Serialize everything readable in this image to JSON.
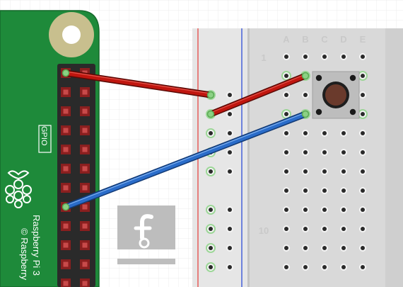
{
  "board": {
    "gpio_label": "GPIO",
    "model_text": "Raspberry Pi 3",
    "copyright_text": "© Raspberry"
  },
  "breadboard": {
    "column_labels": [
      "A",
      "B",
      "C",
      "D",
      "E"
    ],
    "row_labels": [
      "1",
      "10"
    ]
  },
  "colors": {
    "pcb": "#1e8a3a",
    "wire_red": "#c0160f",
    "wire_blue": "#2a6cc9",
    "button_cap": "#6a3a2c",
    "rail_red": "#e53935",
    "rail_blue": "#1e3fd6"
  },
  "logo": {
    "name": "fritzing-logo"
  }
}
